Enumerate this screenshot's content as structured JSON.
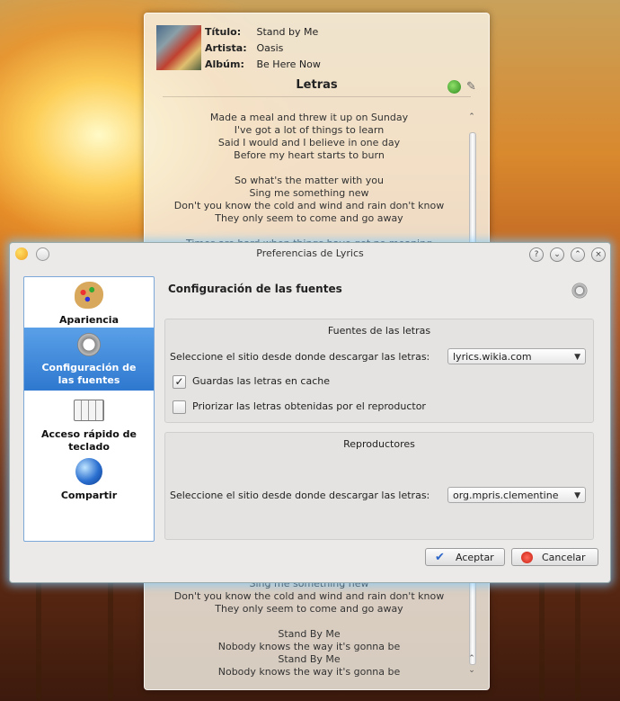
{
  "widget": {
    "title_label": "Título:",
    "title_value": "Stand by Me",
    "artist_label": "Artista:",
    "artist_value": "Oasis",
    "album_label": "Albúm:",
    "album_value": "Be Here Now",
    "lyrics_heading": "Letras",
    "lyrics_top": [
      "Made a meal and threw it up on Sunday",
      "I've got a lot of things to learn",
      "Said I would and I believe in one day",
      "Before my heart starts to burn",
      "",
      "So what's the matter with you",
      "Sing me something new",
      "Don't you know the cold and wind and rain don't know",
      "They only seem to come and go away",
      "",
      "Times are hard when things have got no meaning"
    ],
    "lyrics_bottom": [
      "Sing me something new",
      "Don't you know the cold and wind and rain don't know",
      "They only seem to come and go away",
      "",
      "Stand By Me",
      "Nobody knows the way it's gonna be",
      "Stand By Me",
      "Nobody knows the way it's gonna be"
    ]
  },
  "dialog": {
    "title": "Preferencias de Lyrics",
    "sidebar": [
      {
        "label": "Apariencia",
        "icon": "palette-icon"
      },
      {
        "label": "Configuración de las fuentes",
        "icon": "gear-icon"
      },
      {
        "label": "Acceso rápido de teclado",
        "icon": "keyboard-icon"
      },
      {
        "label": "Compartir",
        "icon": "globe-icon"
      }
    ],
    "page_title": "Configuración de las fuentes",
    "group1": {
      "title": "Fuentes de las letras",
      "site_label": "Seleccione el sitio desde donde descargar las letras:",
      "site_value": "lyrics.wikia.com",
      "cache_label": "Guardas las letras en cache",
      "cache_checked": true,
      "prioritize_label": "Priorizar las letras obtenidas por el reproductor",
      "prioritize_checked": false
    },
    "group2": {
      "title": "Reproductores",
      "site_label": "Seleccione el sitio desde donde descargar las letras:",
      "site_value": "org.mpris.clementine"
    },
    "ok_label": "Aceptar",
    "cancel_label": "Cancelar"
  }
}
